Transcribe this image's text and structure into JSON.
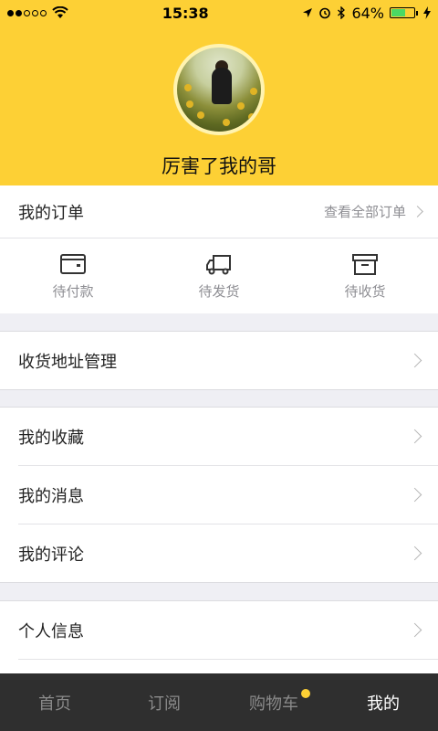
{
  "status_bar": {
    "time": "15:38",
    "battery": "64%",
    "battery_level": 0.64
  },
  "profile": {
    "username": "厉害了我的哥"
  },
  "orders": {
    "title": "我的订单",
    "view_all": "查看全部订单",
    "items": [
      {
        "label": "待付款",
        "icon": "wallet-icon"
      },
      {
        "label": "待发货",
        "icon": "truck-icon"
      },
      {
        "label": "待收货",
        "icon": "box-icon"
      }
    ]
  },
  "menu": {
    "address": "收货地址管理",
    "favorites": "我的收藏",
    "messages": "我的消息",
    "comments": "我的评论",
    "profile_info": "个人信息"
  },
  "tabbar": {
    "tabs": [
      {
        "label": "首页"
      },
      {
        "label": "订阅"
      },
      {
        "label": "购物车"
      },
      {
        "label": "我的"
      }
    ],
    "active_index": 3
  },
  "colors": {
    "accent": "#fdd035",
    "tabbar_bg": "#2f2f2f",
    "battery": "#4cd964"
  }
}
